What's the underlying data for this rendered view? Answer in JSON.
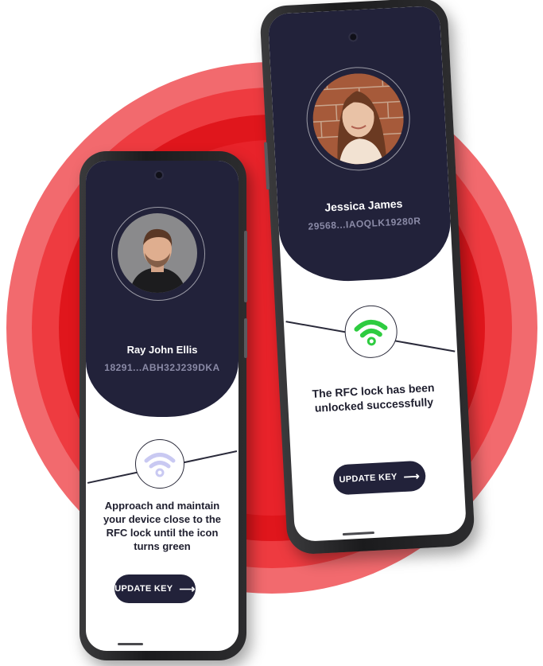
{
  "phone_left": {
    "user_name": "Ray John Ellis",
    "user_key": "18291...ABH32J239DKA",
    "instruction": "Approach and maintain your device close to the RFC lock until the icon turns green",
    "button_label": "UPDATE KEY",
    "wifi_color": "#c9c9f2"
  },
  "phone_right": {
    "user_name": "Jessica James",
    "user_key": "29568...IAOQLK19280R",
    "instruction": "The RFC lock has been unlocked successfully",
    "button_label": "UPDATE KEY",
    "wifi_color": "#2ecc40"
  },
  "colors": {
    "header": "#22223a",
    "accent_red": "#e0161c"
  },
  "icons": [
    "wifi-icon",
    "arrow-right-icon",
    "avatar-photo"
  ]
}
